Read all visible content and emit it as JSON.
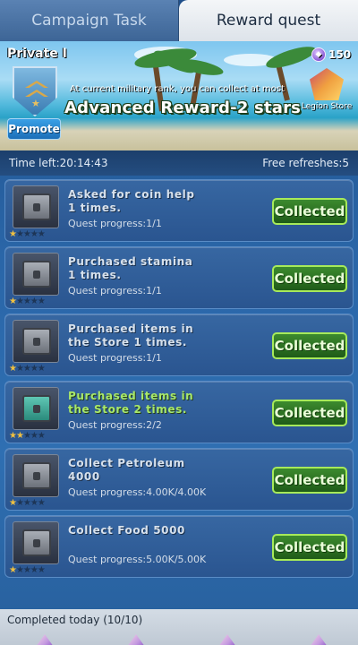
{
  "tabs": [
    {
      "label": "Campaign Task",
      "active": false
    },
    {
      "label": "Reward quest",
      "active": true
    }
  ],
  "banner": {
    "rank_name": "Private I",
    "promote_label": "Promote",
    "military_note": "At current military rank, you can collect at most",
    "reward_title": "Advanced Reward-2 stars",
    "coin_count": "150",
    "store_label": "Legion Store"
  },
  "info": {
    "time_left": "Time left:20:14:43",
    "free_refreshes": "Free refreshes:5"
  },
  "quests": [
    {
      "title": "Asked for coin help 1 times.",
      "progress": "Quest progress:1/1",
      "stars": 1,
      "button": "Collected",
      "highlight": false
    },
    {
      "title": "Purchased stamina 1 times.",
      "progress": "Quest progress:1/1",
      "stars": 1,
      "button": "Collected",
      "highlight": false
    },
    {
      "title": "Purchased items in the Store 1 times.",
      "progress": "Quest progress:1/1",
      "stars": 1,
      "button": "Collected",
      "highlight": false
    },
    {
      "title": "Purchased items in the Store 2 times.",
      "progress": "Quest progress:2/2",
      "stars": 2,
      "button": "Collected",
      "highlight": true
    },
    {
      "title": "Collect Petroleum 4000",
      "progress": "Quest progress:4.00K/4.00K",
      "stars": 1,
      "button": "Collected",
      "highlight": false
    },
    {
      "title": "Collect Food 5000",
      "progress": "Quest progress:5.00K/5.00K",
      "stars": 1,
      "button": "Collected",
      "highlight": false
    }
  ],
  "footer": {
    "completed_today": "Completed today (10/10)"
  },
  "icons": {
    "coin": "gem-coin-icon",
    "rank": "rank-chevron-icon",
    "store": "legion-store-icon",
    "chest": "chest-icon",
    "star": "star-icon"
  },
  "colors": {
    "collected_border": "#a7ea5a",
    "highlight_title": "#a8e86a",
    "star_on": "#f0c040"
  }
}
